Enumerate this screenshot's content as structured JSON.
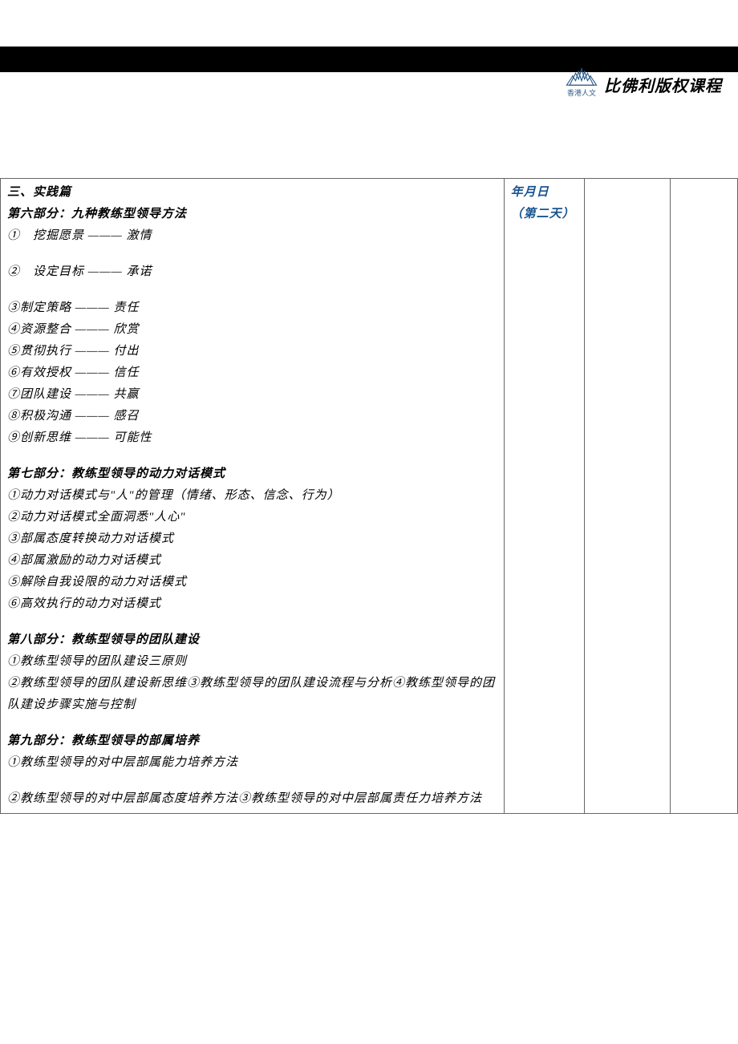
{
  "header": {
    "logo_subtext": "香港人文",
    "title": "比佛利版权课程"
  },
  "main": {
    "section_title": "三、实践篇",
    "part6": {
      "title": "第六部分：九种教练型领导方法",
      "items": [
        "①　挖掘愿景 ——— 激情",
        "②　设定目标 ——— 承诺",
        "③制定策略 ——— 责任",
        "④资源整合 ——— 欣赏",
        "⑤贯彻执行 ——— 付出",
        "⑥有效授权 ——— 信任",
        "⑦团队建设 ——— 共赢",
        "⑧积极沟通 ——— 感召",
        "⑨创新思维 ——— 可能性"
      ]
    },
    "part7": {
      "title": "第七部分：教练型领导的动力对话模式",
      "items": [
        "①动力对话模式与\"人\"的管理（情绪、形态、信念、行为）",
        "②动力对话模式全面洞悉\"人心\"",
        "③部属态度转换动力对话模式",
        "④部属激励的动力对话模式",
        "⑤解除自我设限的动力对话模式",
        "⑥高效执行的动力对话模式"
      ]
    },
    "part8": {
      "title": "第八部分：教练型领导的团队建设",
      "items": [
        "①教练型领导的团队建设三原则",
        "②教练型领导的团队建设新思维③教练型领导的团队建设流程与分析④教练型领导的团队建设步骤实施与控制"
      ]
    },
    "part9": {
      "title": "第九部分：教练型领导的部属培养",
      "items": [
        "①教练型领导的对中层部属能力培养方法",
        "②教练型领导的对中层部属态度培养方法③教练型领导的对中层部属责任力培养方法"
      ]
    }
  },
  "date_info": {
    "line1": "年月日",
    "line2": "（第二天）"
  }
}
